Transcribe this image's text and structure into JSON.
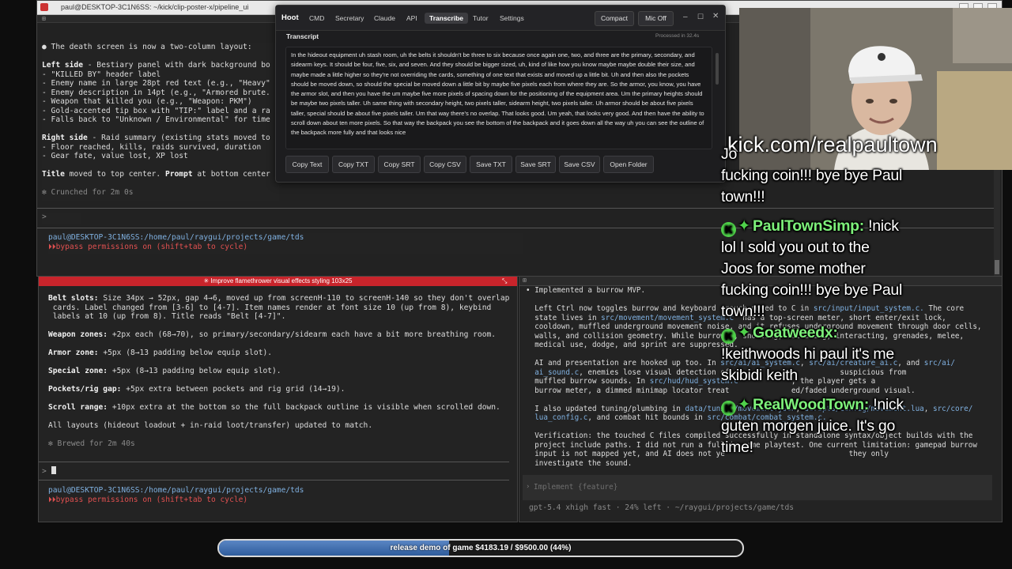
{
  "top_window": {
    "title": "paul@DESKTOP-3C1N6SS: ~/kick/clip-poster-x/pipeline_ui",
    "lines": [
      {
        "t": "● The death screen is now a two-column layout:",
        "c": "grn"
      },
      {
        "t": "",
        "c": ""
      },
      {
        "t": "Left side - Bestiary panel with dark background bo",
        "c": "grn",
        "b": "Left side"
      },
      {
        "t": "- \"KILLED BY\" header label",
        "c": "grn"
      },
      {
        "t": "- Enemy name in large 28pt red text (e.g., \"Heavy\"",
        "c": "grn"
      },
      {
        "t": "- Enemy description in 14pt (e.g., \"Armored brute.",
        "c": "grn"
      },
      {
        "t": "- Weapon that killed you (e.g., \"Weapon: PKM\")",
        "c": "grn"
      },
      {
        "t": "- Gold-accented tip box with \"TIP:\" label and a ra",
        "c": "grn"
      },
      {
        "t": "- Falls back to \"Unknown / Environmental\" for time",
        "c": "grn"
      },
      {
        "t": "",
        "c": ""
      },
      {
        "t": "Right side - Raid summary (existing stats moved to",
        "c": "grn",
        "b": "Right side"
      },
      {
        "t": "- Floor reached, kills, raids survived, duration",
        "c": "grn"
      },
      {
        "t": "- Gear fate, value lost, XP lost",
        "c": "grn"
      },
      {
        "t": "",
        "c": ""
      },
      {
        "t": "Title moved to top center. Prompt at bottom center",
        "c": "grn",
        "b": "Title"
      },
      {
        "t": "",
        "c": ""
      },
      {
        "t": "✻ Crunched for 2m 0s",
        "c": "dim"
      }
    ],
    "prompt_symbol": ">",
    "cwd_line": "paul@DESKTOP-3C1N6SS:/home/paul/raygui/projects/game/tds",
    "bypass_line": "bypass permissions on (shift+tab to cycle)"
  },
  "hoot": {
    "app_name": "Hoot",
    "tabs": [
      "CMD",
      "Secretary",
      "Claude",
      "API",
      "Transcribe",
      "Tutor",
      "Settings"
    ],
    "active_tab": "Transcribe",
    "compact_label": "Compact",
    "mic_label": "Mic Off",
    "section_label": "Transcript",
    "processed": "Processed in 32.4s",
    "transcript": "In the hideout equipment uh stash room, uh the belts it shouldn't be three to six because once again one, two, and three are the primary, secondary, and sidearm keys. It should be four, five, six, and seven. And they should be bigger sized, uh, kind of like how you know maybe maybe double their size, and maybe made a little higher so they're not overriding the cards, something of one text that exists and moved up a little bit. Uh and then also the pockets should be moved down, so should the special be moved down a little bit by maybe five pixels each from where they are. So the armor, you know, you have the armor slot, and then you have the um maybe five more pixels of spacing down for the positioning of the equipment area. Um the primary heights should be maybe two pixels taller. Uh same thing with secondary height, two pixels taller, sidearm height, two pixels taller. Uh armor should be about five pixels taller, special should be about five pixels taller. Um that way there's no overlap. That looks good. Um yeah, that looks very good. And then have the ability to scroll down about ten more pixels. So that way the backpack you see the bottom of the backpack and it goes down all the way uh you can see the outline of the backpack more fully and that looks nice",
    "buttons": [
      "Copy Text",
      "Copy TXT",
      "Copy SRT",
      "Copy CSV",
      "Save TXT",
      "Save SRT",
      "Save CSV",
      "Open Folder"
    ]
  },
  "bottom_left": {
    "title": "✳ Improve flamethrower visual effects styling 103x25",
    "lines": [
      {
        "t": "Belt slots: Size 34px → 52px, gap 4→6, moved up from screenH-110 to screenH-140 so they don't overlap",
        "b": "Belt slots:"
      },
      {
        "t": " cards. Label changed from [3-6] to [4-7]. Item names render at font size 10 (up from 8), keybind"
      },
      {
        "t": " labels at 10 (up from 8). Title reads \"Belt [4-7]\"."
      },
      {
        "t": ""
      },
      {
        "t": "Weapon zones: +2px each (68→70), so primary/secondary/sidearm each have a bit more breathing room.",
        "b": "Weapon zones:"
      },
      {
        "t": ""
      },
      {
        "t": "Armor zone: +5px (8→13 padding below equip slot).",
        "b": "Armor zone:"
      },
      {
        "t": ""
      },
      {
        "t": "Special zone: +5px (8→13 padding below equip slot).",
        "b": "Special zone:"
      },
      {
        "t": ""
      },
      {
        "t": "Pockets/rig gap: +5px extra between pockets and rig grid (14→19).",
        "b": "Pockets/rig gap:"
      },
      {
        "t": ""
      },
      {
        "t": "Scroll range: +10px extra at the bottom so the full backpack outline is visible when scrolled down.",
        "b": "Scroll range:"
      },
      {
        "t": ""
      },
      {
        "t": "All layouts (hideout loadout + in-raid loot/transfer) updated to match."
      },
      {
        "t": ""
      },
      {
        "t": "✻ Brewed for 2m 40s",
        "c": "dim"
      }
    ],
    "cwd_line": "paul@DESKTOP-3C1N6SS:/home/paul/raygui/projects/game/tds",
    "bypass_line": "bypass permissions on (shift+tab to cycle)"
  },
  "bottom_right": {
    "lines": [
      {
        "t": "• Implemented a burrow MVP."
      },
      {
        "t": ""
      },
      {
        "t": "  Left Ctrl now toggles burrow and keyboard crouch moved to C in src/input/input_system.c. The core"
      },
      {
        "t": "  state lives in src/movement/movement_system.c  has a top-screen meter, short enter/exit lock,"
      },
      {
        "t": "  cooldown, muffled underground movement noise, and it refuses underground movement through door cells,"
      },
      {
        "t": "  walls, and collision geometry. While burrowed, shooting, reloading, interacting, grenades, melee,"
      },
      {
        "t": "  medical use, dodge, and sprint are suppressed."
      },
      {
        "t": ""
      },
      {
        "t": "  AI and presentation are hooked up too. In src/ai/ai_system.c, src/ai/creature_ai.c, and src/ai/"
      },
      {
        "t": "  ai_sound.c, enemies lose visual detection of                         suspicious from"
      },
      {
        "t": "  muffled burrow sounds. In src/hud/hud_system.c            , the player gets a"
      },
      {
        "t": "  burrow meter, a dimmed minimap locator treat              ed/faded underground visual."
      },
      {
        "t": ""
      },
      {
        "t": "  I also updated tuning/plumbing in data/tuning/movement.json, scripts/config/movement.lua, src/core/"
      },
      {
        "t": "  lua_config.c, and combat hit bounds in src/combat/combat_system.c."
      },
      {
        "t": ""
      },
      {
        "t": "  Verification: the touched C files compiled successfully in standalone syntax/object builds with the"
      },
      {
        "t": "  project include paths. I did not run a full in-game playtest. One current limitation: gamepad burrow"
      },
      {
        "t": "  input is not mapped yet, and AI does not ye                            they only"
      },
      {
        "t": "  investigate the sound."
      }
    ],
    "placeholder": "Implement {feature}",
    "status": "gpt-5.4 xhigh fast · 24% left · ~/raygui/projects/game/tds"
  },
  "stream_url": "kick.com/realpaultown",
  "chat": [
    {
      "name": "",
      "lines": [
        "Jo",
        "fucking coin!!! bye bye Paul",
        "town!!!"
      ]
    },
    {
      "name": "PaulTownSimp:",
      "msg": "!nick",
      "lines": [
        "lol I sold you out to the",
        "Joos for some mother",
        "fucking coin!!! bye bye Paul",
        "town!!!"
      ]
    },
    {
      "name": "Goatweedx:",
      "msg": "",
      "lines": [
        "!keithwoods hi paul it's me",
        "skibidi keith"
      ]
    },
    {
      "name": "RealWoodTown:",
      "msg": "!nick",
      "lines": [
        "guten morgen juice. It's go",
        "time!"
      ]
    }
  ],
  "goal": {
    "text": "release demo of game $4183.19 / $9500.00 (44%)",
    "fraction": 0.44
  }
}
